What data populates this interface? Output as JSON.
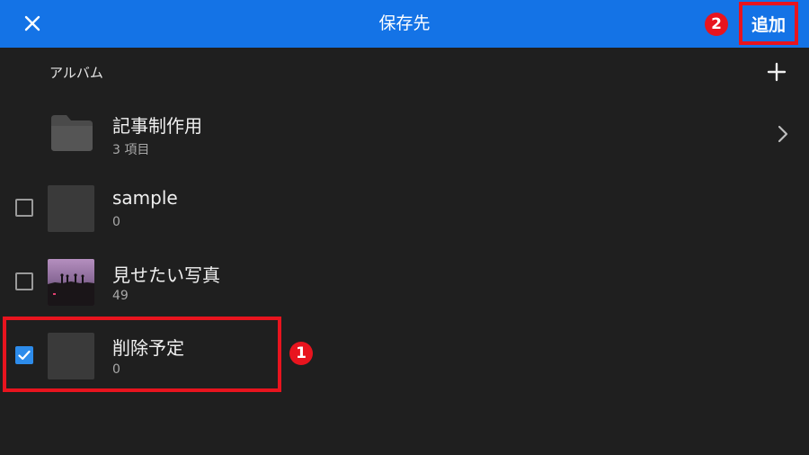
{
  "header": {
    "title": "保存先",
    "add_label": "追加",
    "badge_add": "2"
  },
  "album": {
    "section_label": "アルバム"
  },
  "folder": {
    "name": "記事制作用",
    "count": "3 項目"
  },
  "albums": [
    {
      "name": "sample",
      "count": "0",
      "checked": false
    },
    {
      "name": "見せたい写真",
      "count": "49",
      "checked": false
    },
    {
      "name": "削除予定",
      "count": "0",
      "checked": true
    }
  ],
  "annotations": {
    "badge_selected": "1"
  },
  "colors": {
    "header_bg": "#1473e6",
    "body_bg": "#1f1f1f",
    "highlight": "#e8141e",
    "checkbox_checked": "#2d8ceb"
  },
  "icons": [
    "close-icon",
    "plus-icon",
    "folder-icon",
    "chevron-right-icon",
    "check-icon"
  ]
}
